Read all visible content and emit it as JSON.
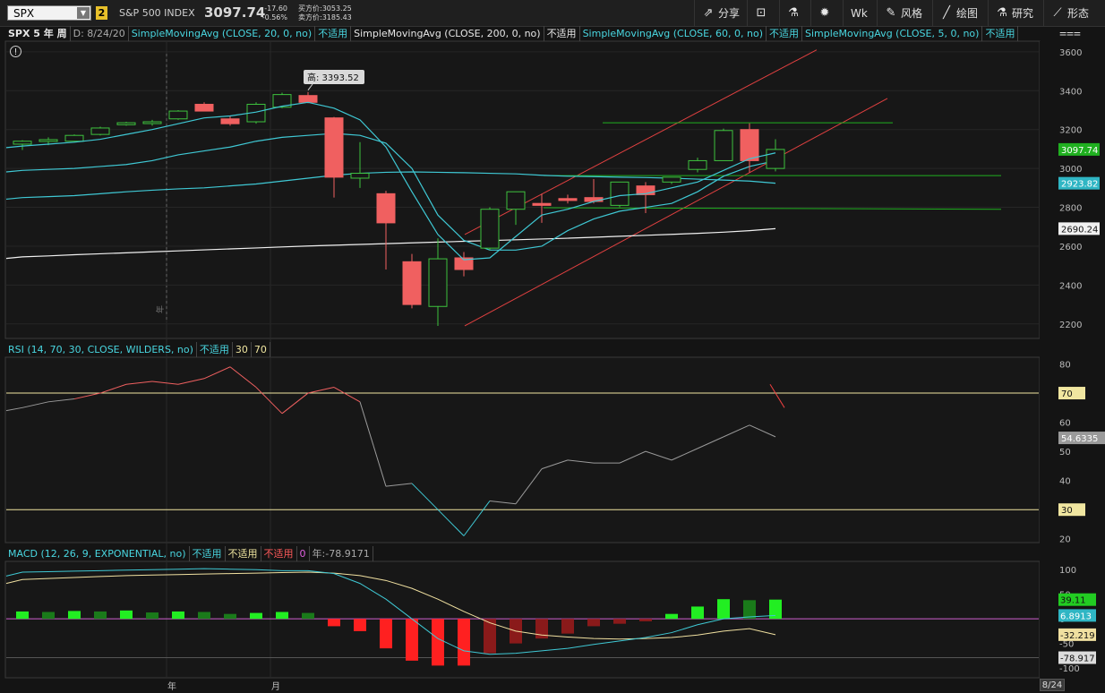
{
  "header": {
    "symbol": "SPX",
    "link_group": "2",
    "index_name": "S&P 500 INDEX",
    "last_price": "3097.74",
    "net_change": "-17.60",
    "pct_change": "-0.56%",
    "bid": "买方价:3053.25",
    "ask": "卖方价:3185.43",
    "toolbar": [
      {
        "label": "分享",
        "icon": "share-icon"
      },
      {
        "label": "",
        "icon": "alert-icon"
      },
      {
        "label": "",
        "icon": "flask-icon"
      },
      {
        "label": "",
        "icon": "gear-icon"
      },
      {
        "label": "Wk",
        "icon": ""
      },
      {
        "label": "风格",
        "icon": "style-icon"
      },
      {
        "label": "绘图",
        "icon": "draw-icon"
      },
      {
        "label": "研究",
        "icon": "studies-icon"
      },
      {
        "label": "形态",
        "icon": "patterns-icon"
      }
    ]
  },
  "price_pane": {
    "title": "SPX 5 年 周",
    "date": "D: 8/24/20",
    "studies": [
      {
        "label": "SimpleMovingAvg (CLOSE, 20, 0, no)",
        "value": "不适用",
        "color": "#49d6e0"
      },
      {
        "label": "SimpleMovingAvg (CLOSE, 200, 0, no)",
        "value": "不适用",
        "color": "#e6e6e6"
      },
      {
        "label": "SimpleMovingAvg (CLOSE, 60, 0, no)",
        "value": "不适用",
        "color": "#49d6e0"
      },
      {
        "label": "SimpleMovingAvg (CLOSE, 5, 0, no)",
        "value": "不适用",
        "color": "#49d6e0"
      }
    ],
    "high_label": "高: 3393.52",
    "price_badges": {
      "last": "3097.74",
      "sma60": "2923.82",
      "sma200": "2690.24"
    },
    "year_marker": "年",
    "info_icon": "info-icon"
  },
  "rsi_pane": {
    "title": "RSI (14, 70, 30, CLOSE, WILDERS, no)",
    "value": "不适用",
    "ob": "30",
    "os": "70",
    "badge_70": "70",
    "badge_30": "30",
    "badge_value": "54.6335",
    "ticks": [
      "80",
      "70",
      "60",
      "50",
      "40",
      "30",
      "20"
    ]
  },
  "macd_pane": {
    "title": "MACD (12, 26, 9, EXPONENTIAL, no)",
    "v1": "不适用",
    "v2": "不适用",
    "v3": "不适用",
    "zero": "0",
    "diff": "年:-78.9171",
    "badges": {
      "hist": "39.11",
      "value": "6.8913",
      "avg": "-32.219",
      "diff": "-78.917"
    },
    "ticks": [
      "100",
      "50",
      "0",
      "-50",
      "-100"
    ]
  },
  "xaxis": {
    "labels": [
      "年",
      "月"
    ],
    "date_badge": "8/24"
  },
  "chart_data": {
    "type": "candlestick",
    "title": "SPX 5 年 周",
    "price_axis": {
      "ticks": [
        2200,
        2400,
        2600,
        2800,
        3000,
        3200,
        3400,
        3600
      ],
      "range": [
        2130,
        3650
      ]
    },
    "candles": [
      {
        "o": 3125,
        "h": 3145,
        "l": 3095,
        "c": 3140
      },
      {
        "o": 3142,
        "h": 3160,
        "l": 3120,
        "c": 3148
      },
      {
        "o": 3140,
        "h": 3175,
        "l": 3135,
        "c": 3170
      },
      {
        "o": 3175,
        "h": 3215,
        "l": 3170,
        "c": 3208
      },
      {
        "o": 3225,
        "h": 3240,
        "l": 3220,
        "c": 3235
      },
      {
        "o": 3235,
        "h": 3250,
        "l": 3220,
        "c": 3240
      },
      {
        "o": 3255,
        "h": 3300,
        "l": 3250,
        "c": 3295
      },
      {
        "o": 3330,
        "h": 3340,
        "l": 3300,
        "c": 3295
      },
      {
        "o": 3255,
        "h": 3270,
        "l": 3220,
        "c": 3230
      },
      {
        "o": 3240,
        "h": 3340,
        "l": 3230,
        "c": 3330
      },
      {
        "o": 3315,
        "h": 3390,
        "l": 3310,
        "c": 3380
      },
      {
        "o": 3375,
        "h": 3393,
        "l": 3335,
        "c": 3340
      },
      {
        "o": 3260,
        "h": 3265,
        "l": 2850,
        "c": 2955
      },
      {
        "o": 2950,
        "h": 3135,
        "l": 2900,
        "c": 2975
      },
      {
        "o": 2870,
        "h": 2885,
        "l": 2480,
        "c": 2720
      },
      {
        "o": 2520,
        "h": 2560,
        "l": 2280,
        "c": 2300
      },
      {
        "o": 2290,
        "h": 2640,
        "l": 2190,
        "c": 2535
      },
      {
        "o": 2540,
        "h": 2570,
        "l": 2445,
        "c": 2480
      },
      {
        "o": 2590,
        "h": 2800,
        "l": 2580,
        "c": 2790
      },
      {
        "o": 2790,
        "h": 2880,
        "l": 2710,
        "c": 2880
      },
      {
        "o": 2820,
        "h": 2870,
        "l": 2720,
        "c": 2810
      },
      {
        "o": 2845,
        "h": 2865,
        "l": 2820,
        "c": 2835
      },
      {
        "o": 2850,
        "h": 2945,
        "l": 2820,
        "c": 2830
      },
      {
        "o": 2810,
        "h": 2930,
        "l": 2800,
        "c": 2930
      },
      {
        "o": 2910,
        "h": 2930,
        "l": 2770,
        "c": 2865
      },
      {
        "o": 2930,
        "h": 2955,
        "l": 2920,
        "c": 2955
      },
      {
        "o": 2995,
        "h": 3055,
        "l": 2980,
        "c": 3040
      },
      {
        "o": 3040,
        "h": 3205,
        "l": 3040,
        "c": 3195
      },
      {
        "o": 3200,
        "h": 3232,
        "l": 2980,
        "c": 3040
      },
      {
        "o": 3000,
        "h": 3150,
        "l": 2985,
        "c": 3097.74
      }
    ],
    "sma20": [
      2990,
      2995,
      3000,
      3010,
      3020,
      3040,
      3070,
      3090,
      3110,
      3140,
      3160,
      3170,
      3180,
      3170,
      3130,
      3000,
      2760,
      2630,
      2580,
      2580,
      2600,
      2680,
      2740,
      2780,
      2800,
      2820,
      2880,
      2960,
      3010,
      3040
    ],
    "sma60": [
      2850,
      2855,
      2860,
      2870,
      2880,
      2888,
      2895,
      2900,
      2910,
      2920,
      2935,
      2950,
      2965,
      2975,
      2980,
      2982,
      2980,
      2978,
      2975,
      2972,
      2965,
      2960,
      2958,
      2955,
      2953,
      2950,
      2945,
      2940,
      2935,
      2924
    ],
    "sma5": [
      3115,
      3125,
      3135,
      3150,
      3175,
      3200,
      3230,
      3260,
      3270,
      3290,
      3320,
      3340,
      3310,
      3250,
      3110,
      2880,
      2660,
      2530,
      2540,
      2650,
      2760,
      2790,
      2830,
      2860,
      2870,
      2900,
      2930,
      2990,
      3050,
      3080
    ],
    "sma200": [
      2545,
      2550,
      2556,
      2561,
      2566,
      2571,
      2576,
      2581,
      2586,
      2591,
      2596,
      2601,
      2605,
      2609,
      2613,
      2617,
      2621,
      2625,
      2629,
      2633,
      2637,
      2641,
      2646,
      2651,
      2656,
      2661,
      2666,
      2672,
      2680,
      2690.24
    ],
    "rsi": [
      65,
      67,
      68,
      70,
      73,
      74,
      73,
      75,
      79,
      72,
      63,
      70,
      72,
      67,
      38,
      39,
      30,
      21,
      33,
      32,
      44,
      47,
      46,
      46,
      50,
      47,
      51,
      55,
      59,
      55.0
    ],
    "rsi_axis": {
      "ticks": [
        20,
        30,
        40,
        50,
        60,
        70,
        80
      ],
      "range": [
        19,
        82
      ]
    },
    "macd_value": [
      95,
      96,
      97,
      98,
      99,
      100,
      101,
      102,
      101,
      100,
      98,
      98,
      92,
      72,
      40,
      0,
      -40,
      -65,
      -72,
      -70,
      -65,
      -60,
      -52,
      -45,
      -38,
      -28,
      -12,
      0,
      4,
      6.8913
    ],
    "macd_avg": [
      80,
      82,
      84,
      86,
      88,
      89,
      90,
      91,
      92,
      93,
      94,
      95,
      93,
      88,
      78,
      62,
      40,
      15,
      -8,
      -25,
      -33,
      -37,
      -40,
      -41,
      -40,
      -38,
      -33,
      -25,
      -20,
      -32.219
    ],
    "macd_hist": [
      15,
      14,
      16,
      15,
      17,
      13,
      15,
      14,
      10,
      12,
      14,
      12,
      -15,
      -25,
      -60,
      -85,
      -95,
      -95,
      -70,
      -50,
      -40,
      -30,
      -15,
      -10,
      -5,
      10,
      25,
      40,
      38,
      39.11
    ],
    "macd_axis": {
      "ticks": [
        -100,
        -50,
        0,
        50,
        100
      ],
      "range": [
        -118,
        115
      ]
    }
  }
}
